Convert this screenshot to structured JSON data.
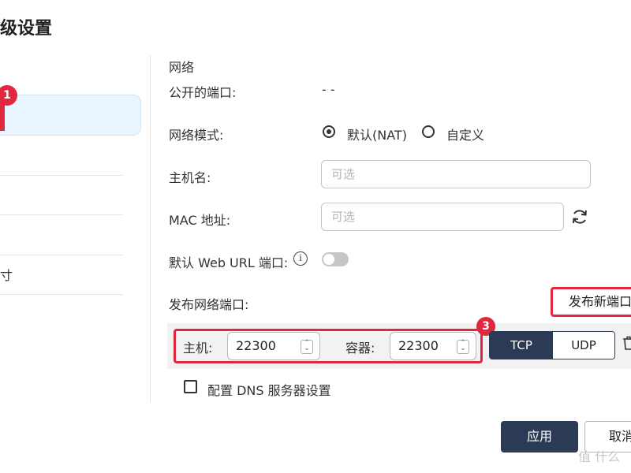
{
  "window": {
    "title": "级设置"
  },
  "sidebar": {
    "selected_badge": "1",
    "item_text": "寸"
  },
  "network": {
    "section_title": "网络",
    "public_port_label": "公开的端口:",
    "public_port_value": "- -",
    "mode_label": "网络模式:",
    "mode_options": [
      {
        "label": "默认(NAT)",
        "selected": true
      },
      {
        "label": "自定义",
        "selected": false
      }
    ],
    "hostname_label": "主机名:",
    "hostname_placeholder": "可选",
    "mac_label": "MAC 地址:",
    "mac_placeholder": "可选",
    "web_url_label": "默认 Web URL 端口:",
    "web_url_enabled": false,
    "info_icon": "i",
    "publish_label": "发布网络端口:",
    "publish_button": "发布新端口",
    "port_mapping": {
      "host_label": "主机:",
      "host_value": "22300",
      "container_label": "容器:",
      "container_value": "22300",
      "badge": "3",
      "protocols": [
        "TCP",
        "UDP"
      ],
      "selected_protocol": "TCP"
    },
    "dns_label": "配置 DNS 服务器设置",
    "dns_checked": false
  },
  "footer": {
    "apply": "应用",
    "cancel": "取消"
  },
  "watermark": "值 什么",
  "colors": {
    "accent": "#2b3a55",
    "highlight": "#e0293e",
    "selected_bg": "#e9f6ff"
  }
}
